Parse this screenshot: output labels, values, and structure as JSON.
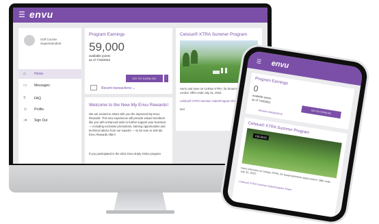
{
  "app": {
    "brand": "envu",
    "accent": "#7b4fa8"
  },
  "sidebar": {
    "user_line1": "Golf Course",
    "user_line2": "Superintendent",
    "items": [
      {
        "label": "Home",
        "icon": "home-icon",
        "active": true
      },
      {
        "label": "Messages",
        "icon": "message-icon"
      },
      {
        "label": "FAQ",
        "icon": "help-icon"
      },
      {
        "label": "Profile",
        "icon": "user-icon"
      },
      {
        "label": "Sign Out",
        "icon": "signout-icon"
      }
    ]
  },
  "earnings": {
    "title": "Program Earnings",
    "points": "59,000",
    "points_label": "available points",
    "as_of": "as of 7/18/2022",
    "catalog_button": "GO TO CATALOG",
    "recent": "Recent transactions"
  },
  "celsius": {
    "title": "Celsius® XTRA Summer Program",
    "body": "Hurry and save on Celsius XTRA, for broad-spectrum weed control. Offer ends July 31, 2022.",
    "link": "Celsius® XTRA Summer SalesProgram Sheet",
    "more": "text"
  },
  "welcome": {
    "title": "Welcome to the New My Envu Rewards!",
    "body": "We are excited to share with you the improved My Envu Rewards. This new experience will provide valued members like you with enhanced tools to further support your business — including exclusive promotions, training opportunities and technical advice from our experts — so be sure to visit My Envu Rewards often!",
    "body2": "If you participated in the 2021 Envu Early Order program"
  },
  "phone": {
    "title": "Program Earnings",
    "points": "0",
    "points_label": "available points",
    "as_of": "as of 7/18/2022",
    "catalog_button": "GO TO CATALOG",
    "recent": "Recent transactions",
    "celsius_title": "Celsius® XTRA Summer Program",
    "badge": "CELSIUS",
    "body": "Hurry and save on Celsius XTRA, for broad-spectrum weed control. Offer ends July 31, 2022.",
    "link": "Celsius® XTRA Summer SalesProgram Sheet"
  }
}
